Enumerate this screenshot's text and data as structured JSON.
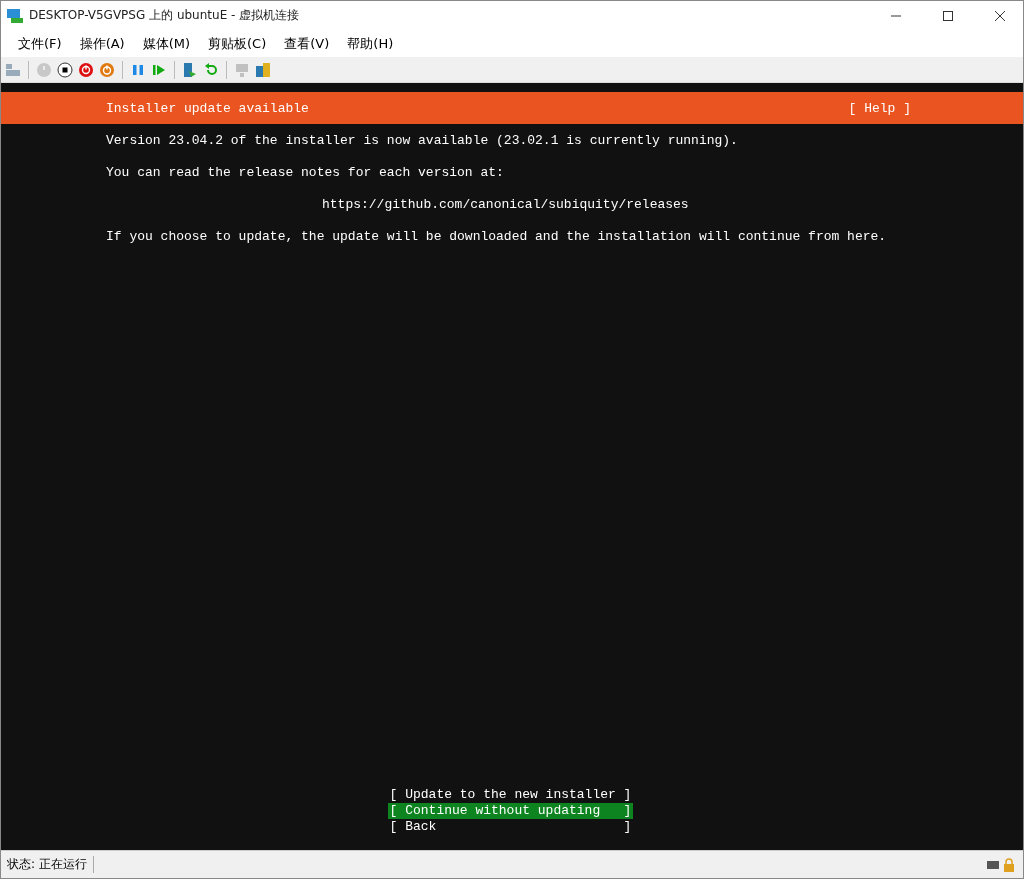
{
  "window": {
    "title": "DESKTOP-V5GVPSG 上的 ubuntuE - 虚拟机连接"
  },
  "menu": [
    "文件(F)",
    "操作(A)",
    "媒体(M)",
    "剪贴板(C)",
    "查看(V)",
    "帮助(H)"
  ],
  "toolbar": [
    {
      "kind": "ctrl-alt-del",
      "disabled": false
    },
    {
      "kind": "sep"
    },
    {
      "kind": "start",
      "disabled": true
    },
    {
      "kind": "turnoff",
      "disabled": false
    },
    {
      "kind": "shutdown",
      "disabled": false
    },
    {
      "kind": "save",
      "disabled": false
    },
    {
      "kind": "sep"
    },
    {
      "kind": "pause",
      "disabled": false
    },
    {
      "kind": "reset",
      "disabled": false
    },
    {
      "kind": "sep"
    },
    {
      "kind": "checkpoint",
      "disabled": false
    },
    {
      "kind": "revert",
      "disabled": false
    },
    {
      "kind": "sep"
    },
    {
      "kind": "enhanced",
      "disabled": true
    },
    {
      "kind": "share",
      "disabled": false
    }
  ],
  "installer": {
    "header": "Installer update available",
    "help": "[ Help ]",
    "paragraphs": [
      {
        "text": "Version 23.04.2 of the installer is now available (23.02.1 is currently running).",
        "kind": "text"
      },
      {
        "text": "You can read the release notes for each version at:",
        "kind": "text"
      },
      {
        "text": "https://github.com/canonical/subiquity/releases",
        "kind": "url"
      },
      {
        "text": "If you choose to update, the update will be downloaded and the installation will continue from here.",
        "kind": "text"
      }
    ],
    "options": [
      {
        "text": "[ Update to the new installer ]",
        "selected": false
      },
      {
        "text": "[ Continue without updating   ]",
        "selected": true
      },
      {
        "text": "[ Back                        ]",
        "selected": false
      }
    ]
  },
  "status_bar": {
    "text": "状态: 正在运行"
  }
}
